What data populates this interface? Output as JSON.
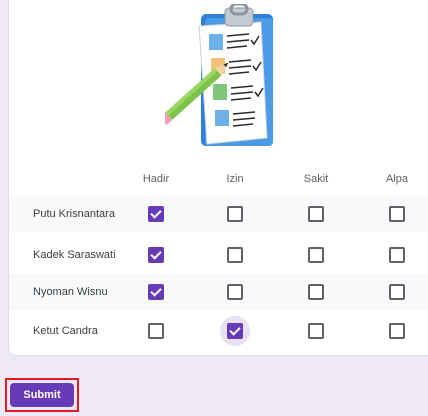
{
  "grid": {
    "columns": [
      "Hadir",
      "Izin",
      "Sakit",
      "Alpa"
    ],
    "rows": [
      {
        "label": "Putu Krisnantara",
        "checked": [
          true,
          false,
          false,
          false
        ]
      },
      {
        "label": "Kadek Saraswati",
        "checked": [
          true,
          false,
          false,
          false
        ]
      },
      {
        "label": "Nyoman Wisnu",
        "checked": [
          true,
          false,
          false,
          false
        ]
      },
      {
        "label": "Ketut Candra",
        "checked": [
          false,
          true,
          false,
          false
        ]
      }
    ]
  },
  "illustration": {
    "icon": "clipboard-checklist-with-pencil-icon"
  },
  "actions": {
    "submit_label": "Submit"
  },
  "colors": {
    "accent": "#673ab7",
    "page_background": "#efe9f7",
    "highlight_border": "#e01b24"
  }
}
